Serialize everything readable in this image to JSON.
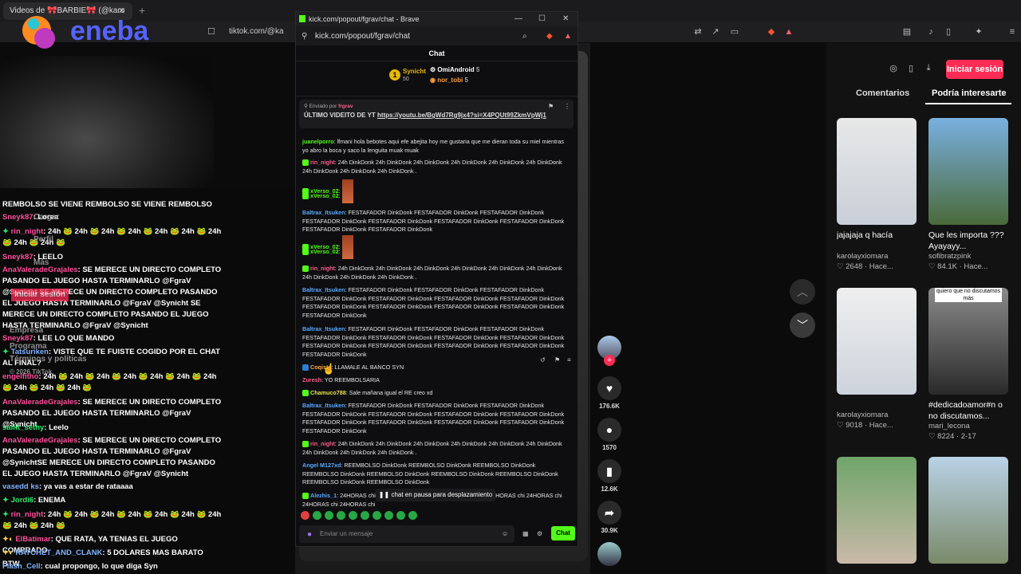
{
  "browser": {
    "tab_title": "Videos de 🎀BARBIE🎀 (@karo",
    "tab_close": "✕",
    "new_tab": "+",
    "address_partial": "tiktok.com/@ka",
    "brand_overlay": "eneba"
  },
  "kick_window": {
    "title": "kick.com/popout/fgrav/chat - Brave",
    "address": "kick.com/popout/fgrav/chat",
    "chat_header": "Chat",
    "gifters": [
      {
        "rank": "1",
        "name": "Synicht",
        "count": "50"
      },
      {
        "name": "OmiAndroid",
        "count": "5"
      },
      {
        "name": "nor_tobi",
        "count": "5"
      }
    ],
    "pinned": {
      "sent_by_label": "Enviado por",
      "sender": "frgrav",
      "text_prefix": "ÚLTIMO VIDEITO DE YT",
      "link": "https://youtu.be/BgWd7Rg9jx4?si=X4PQUt99ZkmVpWj1"
    },
    "messages": [
      {
        "user": "juanelporro",
        "text": ": lfmani hola bebotes aqui efe abejita hoy me gustaria que me dieran toda su miel mientras yo abro la boca y saco la lenguita muak muak"
      },
      {
        "user": "rin_night",
        "text": ": 24h DinkDonk 24h DinkDonk 24h DinkDonk 24h DinkDonk 24h DinkDonk 24h DinkDonk 24h DinkDonk 24h DinkDonk 24h DinkDonk ."
      },
      {
        "user": "xVerso_02",
        "text": ":"
      },
      {
        "user": "xVerso_02",
        "text": ":"
      },
      {
        "user": "Baltrax_Itsuken",
        "text": ": FESTAFADOR DinkDonk FESTAFADOR DinkDonk FESTAFADOR DinkDonk FESTAFADOR DinkDonk FESTAFADOR DinkDonk FESTAFADOR DinkDonk FESTAFADOR DinkDonk FESTAFADOR DinkDonk FESTAFADOR DinkDonk"
      },
      {
        "user": "xVerso_02",
        "text": ":"
      },
      {
        "user": "xVerso_02",
        "text": ":"
      },
      {
        "user": "rin_night",
        "text": ": 24h DinkDonk 24h DinkDonk 24h DinkDonk 24h DinkDonk 24h DinkDonk 24h DinkDonk 24h DinkDonk 24h DinkDonk 24h DinkDonk ."
      },
      {
        "user": "Baltrax_Itsuken",
        "text": ": FESTAFADOR DinkDonk FESTAFADOR DinkDonk FESTAFADOR DinkDonk FESTAFADOR DinkDonk FESTAFADOR DinkDonk FESTAFADOR DinkDonk FESTAFADOR DinkDonk FESTAFADOR DinkDonk FESTAFADOR DinkDonk FESTAFADOR DinkDonk FESTAFADOR DinkDonk FESTAFADOR DinkDonk"
      },
      {
        "user": "Baltrax_Itsuken",
        "text": ": FESTAFADOR DinkDonk FESTAFADOR DinkDonk FESTAFADOR DinkDonk FESTAFADOR DinkDonk FESTAFADOR DinkDonk FESTAFADOR DinkDonk FESTAFADOR DinkDonk FESTAFADOR DinkDonk FESTAFADOR DinkDonk FESTAFADOR DinkDonk FESTAFADOR DinkDonk FESTAFADOR DinkDonk"
      },
      {
        "user": "Coqiste",
        "text": ": LLAMALE AL BANCO SYN"
      },
      {
        "user": "Zuresh",
        "text": ": YO REEMBOLSARIA"
      },
      {
        "user": "Chamuco788",
        "text": ": Sale mañana igual el RE creo xd"
      },
      {
        "user": "Baltrax_Itsuken",
        "text": ": FESTAFADOR DinkDonk FESTAFADOR DinkDonk FESTAFADOR DinkDonk FESTAFADOR DinkDonk FESTAFADOR DinkDonk FESTAFADOR DinkDonk FESTAFADOR DinkDonk FESTAFADOR DinkDonk FESTAFADOR DinkDonk FESTAFADOR DinkDonk FESTAFADOR DinkDonk FESTAFADOR DinkDonk"
      },
      {
        "user": "rin_night",
        "text": ": 24h DinkDonk 24h DinkDonk 24h DinkDonk 24h DinkDonk 24h DinkDonk 24h DinkDonk 24h DinkDonk 24h DinkDonk 24h DinkDonk ."
      },
      {
        "user": "Angel M127xd",
        "text": ": REEMBOLSO DinkDonk REEMBOLSO DinkDonk REEMBOLSO DinkDonk REEMBOLSO DinkDonk REEMBOLSO DinkDonk REEMBOLSO DinkDonk REEMBOLSO DinkDonk REEMBOLSO DinkDonk REEMBOLSO DinkDonk"
      },
      {
        "user": "Alezhis_1",
        "text": ": 24HORAS chi 24HORAS chi 24HORAS chi 24HORAS chi 24HORAS chi 24HORAS chi 24HORAS chi 24HORAS chi"
      }
    ],
    "pause_label": "chat en pausa para desplazamiento",
    "input_placeholder": "Enviar un mensaje",
    "send_label": "Chat"
  },
  "stream_chat": [
    {
      "user": "",
      "text": "REMBOLSO SE VIENE REMBOLSO SE VIENE REMBOLSO"
    },
    {
      "user": "Sneyk87",
      "text": ": Lorea"
    },
    {
      "user": "rin_night",
      "text": ": 24h 🐸 24h 🐸 24h 🐸 24h 🐸 24h 🐸 24h 🐸 24h 🐸 24h 🐸 24h 🐸"
    },
    {
      "user": "Sneyk87",
      "text": ": LEELO"
    },
    {
      "user": "AnaValeradeGrajales",
      "text": ": SE MERECE UN DIRECTO COMPLETO PASANDO EL JUEGO HASTA TERMINARLO @FgraV @Synicht SE MERECE UN DIRECTO COMPLETO PASANDO EL JUEGO HASTA TERMINARLO @FgraV @Synicht SE MERECE UN DIRECTO COMPLETO PASANDO EL JUEGO HASTA TERMINARLO @FgraV @Synicht"
    },
    {
      "user": "Sneyk87",
      "text": ": LEE LO QUE MANDO"
    },
    {
      "user": "Tatsuriken",
      "text": ": VISTE QUE TE FUISTE COGIDO POR EL CHAT AL FINAL?"
    },
    {
      "user": "engelfitho",
      "text": ": 24h 🐸 24h 🐸 24h 🐸 24h 🐸 24h 🐸 24h 🐸 24h 🐸 24h 🐸 24h 🐸 24h 🐸"
    },
    {
      "user": "AnaValeradeGrajales",
      "text": ": SE MERECE UN DIRECTO COMPLETO PASANDO EL JUEGO HASTA TERMINARLO @FgraV @Synicht"
    },
    {
      "user": "saint_sethy",
      "text": ": Leelo"
    },
    {
      "user": "AnaValeradeGrajales",
      "text": ": SE MERECE UN DIRECTO COMPLETO PASANDO EL JUEGO HASTA TERMINARLO @FgraV @SynichtSE MERECE UN DIRECTO COMPLETO PASANDO EL JUEGO HASTA TERMINARLO @FgraV @Synicht"
    },
    {
      "user": "vasedd ks",
      "text": ": ya vas a estar de rataaaa"
    },
    {
      "user": "Jordi6",
      "text": ": ENEMA"
    },
    {
      "user": "rin_night",
      "text": ": 24h 🐸 24h 🐸 24h 🐸 24h 🐸 24h 🐸 24h 🐸 24h 🐸 24h 🐸 24h 🐸"
    },
    {
      "user": "ElBatimar",
      "text": ": QUE RATA, YA TENIAS EL JUEGO COMPRADO"
    },
    {
      "user": "RATCHET_AND_CLANK",
      "text": ": 5 DOLARES MAS BARATO BTW"
    },
    {
      "user": "Flash_Cell",
      "text": ": cual propongo, lo que diga Syn"
    }
  ],
  "faded_menu": {
    "cargar": "Cargar",
    "perfil": "Perfil",
    "mas": "Más",
    "empresa": "Empresa",
    "programa": "Programa",
    "terminos": "Términos y políticas",
    "copyright": "© 2026 TikTok",
    "login_hint": "Iniciar sesión"
  },
  "tiktok_sidebar": {
    "likes": "176.6K",
    "comments": "1570",
    "saves": "12.6K",
    "shares": "30.9K"
  },
  "tiktok_right": {
    "login_button": "Iniciar sesión",
    "tab_comments": "Comentarios",
    "tab_interest": "Podría interesarte",
    "cards": [
      {
        "title": "jajajaja q hacía",
        "user": "karolayxiomara",
        "meta": "♡ 2648 · Hace..."
      },
      {
        "title": "Que les importa ??? Ayayayy...",
        "user": "sofibratzpink",
        "meta": "♡ 84.1K · Hace..."
      },
      {
        "title": "",
        "user": "karolayxiomara",
        "meta": "♡ 9018 · Hace..."
      },
      {
        "title": "#dedicadoamor#n o no discutamos...",
        "user": "mari_lecona",
        "meta": "♡ 8224 · 2-17",
        "overlay": "quiero que no discutamos más"
      },
      {
        "title": "",
        "user": "",
        "meta": ""
      },
      {
        "title": "",
        "user": "",
        "meta": ""
      }
    ]
  },
  "colors": {
    "kick_green": "#53fc18",
    "tiktok_red": "#fe2c55"
  }
}
